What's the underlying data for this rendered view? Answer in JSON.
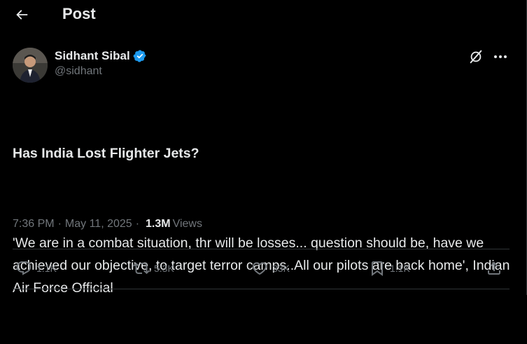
{
  "header": {
    "title": "Post",
    "back_icon": "arrow-left-icon"
  },
  "author": {
    "name": "Sidhant Sibal",
    "handle": "@sidhant",
    "verified": true,
    "verified_color": "#1d9bf0"
  },
  "tweet": {
    "title": "Has India Lost Flighter Jets?",
    "body": "'We are in a combat situation, thr will be losses... question should be, have we achieved our objective, to target terror camps..All our pilots are back home', Indian Air Force Official"
  },
  "meta": {
    "time": "7:36 PM",
    "separator": "·",
    "date": "May 11, 2025",
    "views_count": "1.3M",
    "views_label": "Views"
  },
  "actions": {
    "replies": "1.1K",
    "reposts": "5.3K",
    "likes": "33K",
    "bookmarks": "1.1K"
  },
  "colors": {
    "background": "#000000",
    "text": "#e7e9ea",
    "muted": "#71767b",
    "divider": "#2f3336"
  }
}
